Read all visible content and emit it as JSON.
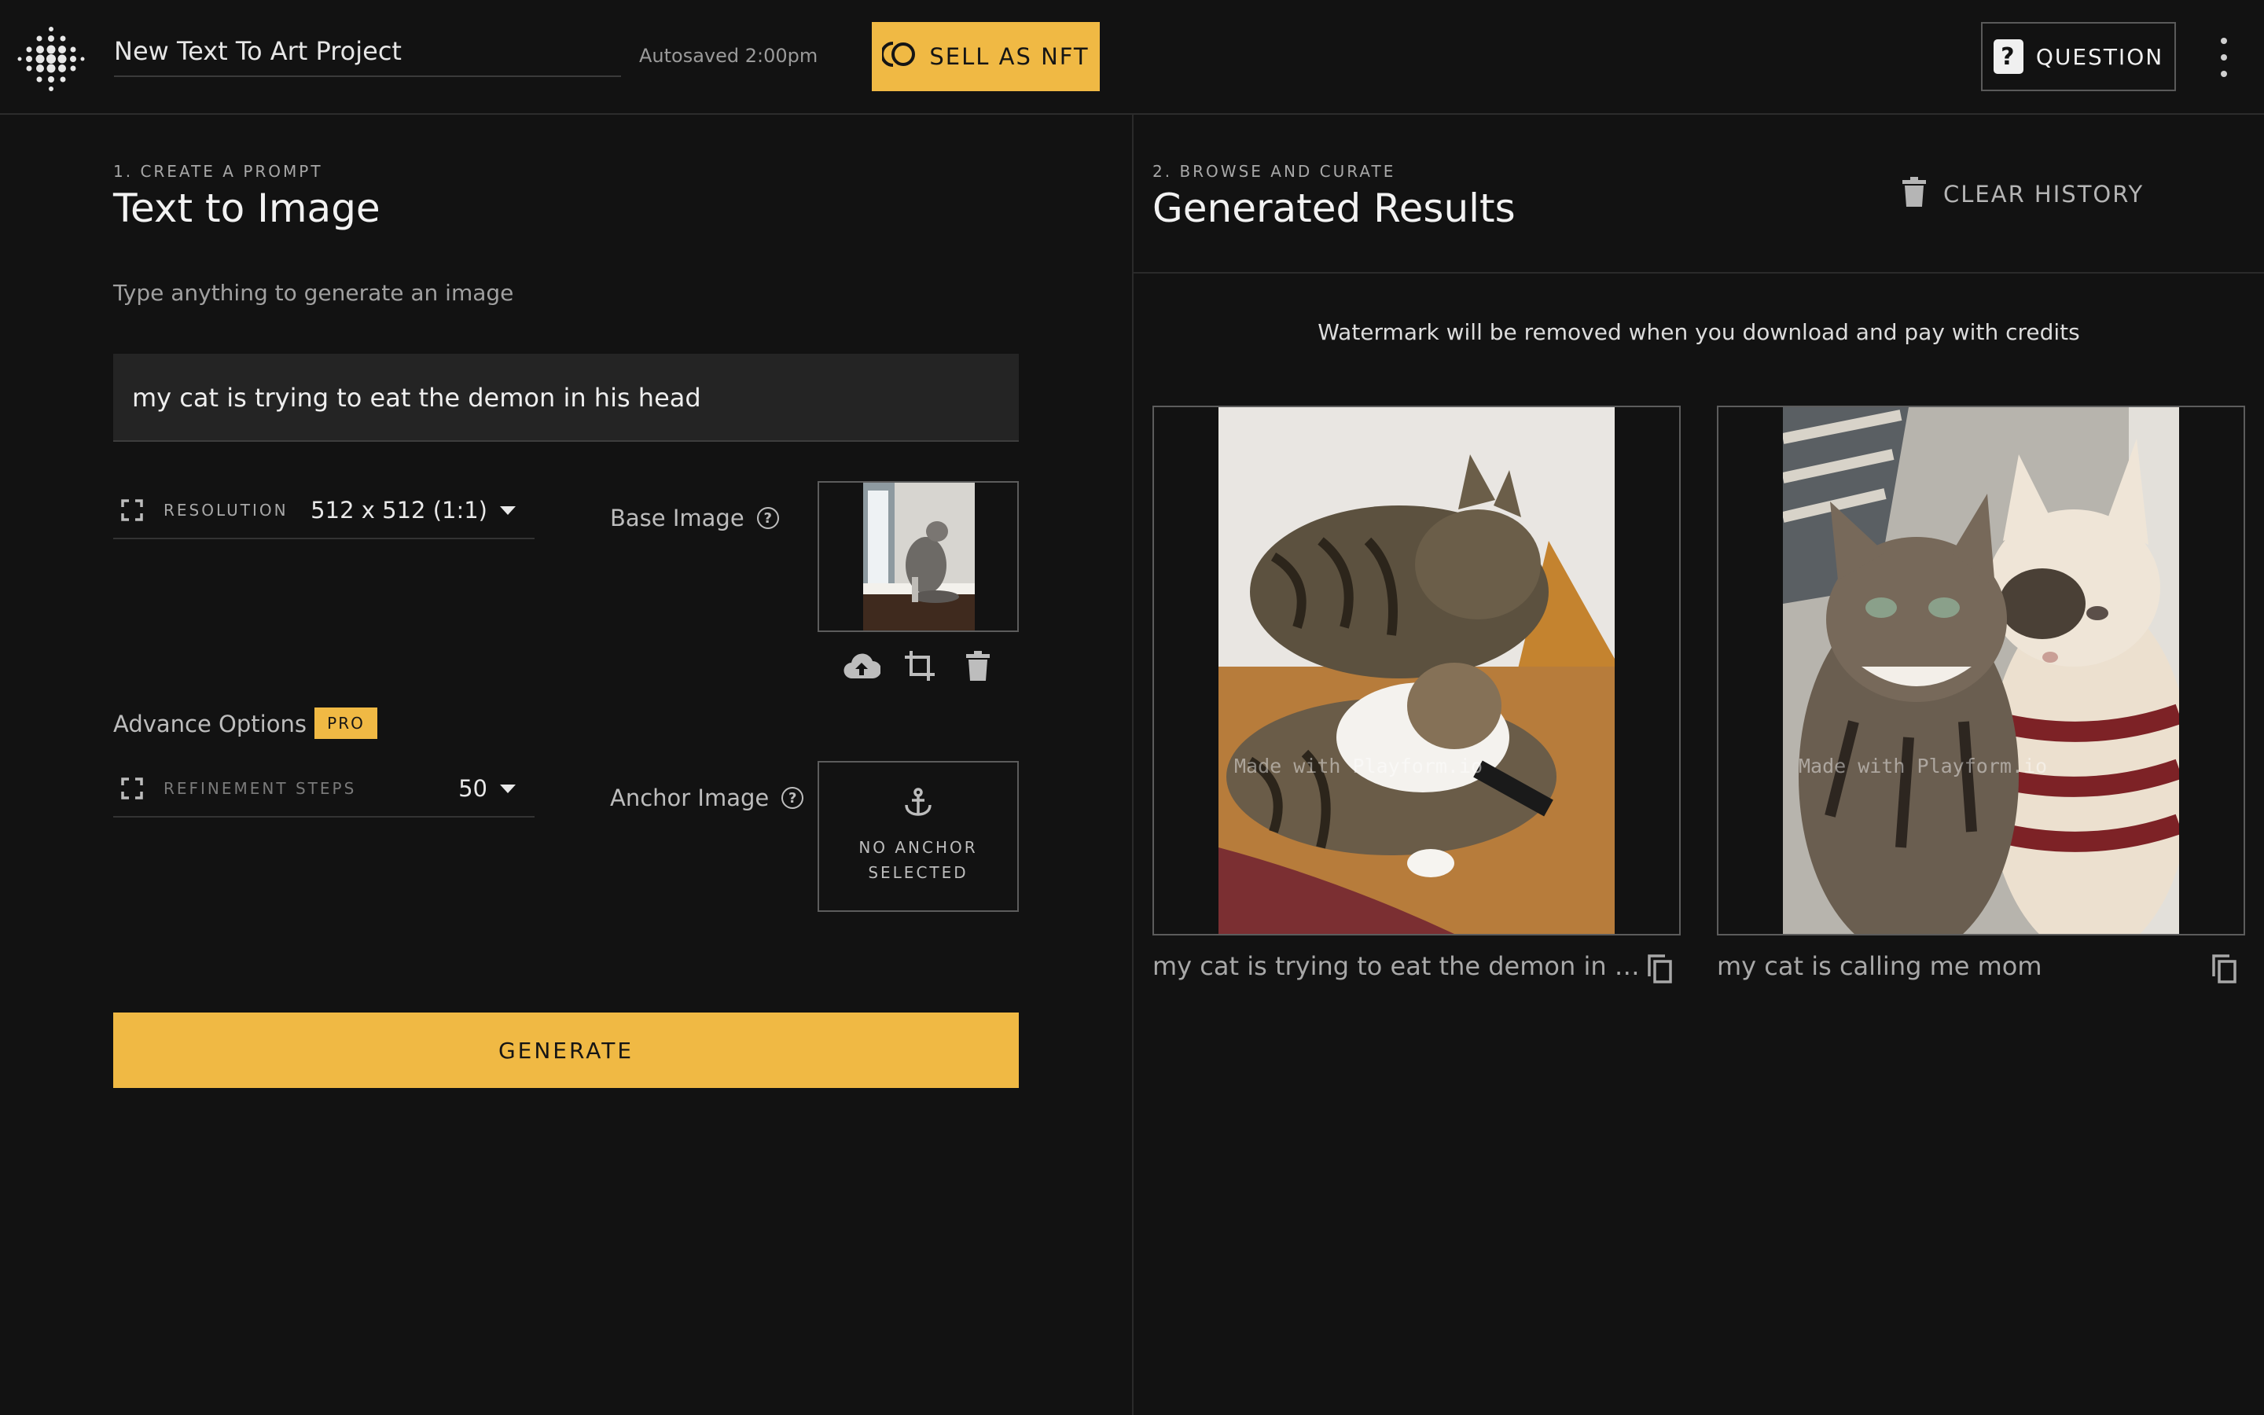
{
  "header": {
    "project_name": "New Text To Art Project",
    "autosaved": "Autosaved 2:00pm",
    "nft_button": "SELL AS NFT",
    "question_button": "QUESTION",
    "icons": [
      "logo-dots-icon",
      "nft-coin-icon",
      "question-icon",
      "more-vert-icon"
    ]
  },
  "left": {
    "step_label": "1. CREATE A PROMPT",
    "title": "Text to Image",
    "helper": "Type anything to generate an image",
    "prompt": "my cat is trying to eat the demon in his head",
    "resolution": {
      "label": "RESOLUTION",
      "value": "512 x 512 (1:1)"
    },
    "base_image": {
      "label": "Base Image",
      "help": "?"
    },
    "advance_options": {
      "label": "Advance Options",
      "badge": "PRO"
    },
    "refinement": {
      "label": "REFINEMENT STEPS",
      "value": "50"
    },
    "anchor_image": {
      "label": "Anchor Image",
      "help": "?",
      "empty_text": "NO ANCHOR SELECTED"
    },
    "generate_button": "GENERATE"
  },
  "right": {
    "step_label": "2. BROWSE AND CURATE",
    "title": "Generated Results",
    "clear_button": "CLEAR HISTORY",
    "watermark_note": "Watermark will be removed when you download and pay with credits",
    "results": [
      {
        "caption": "my cat is trying to eat the demon in hi...",
        "watermark": "Made with Playform.io"
      },
      {
        "caption": "my cat is calling me mom",
        "watermark": "Made with Playform.io"
      }
    ]
  },
  "colors": {
    "accent": "#f0b944",
    "background": "#121212",
    "field": "#242424"
  }
}
